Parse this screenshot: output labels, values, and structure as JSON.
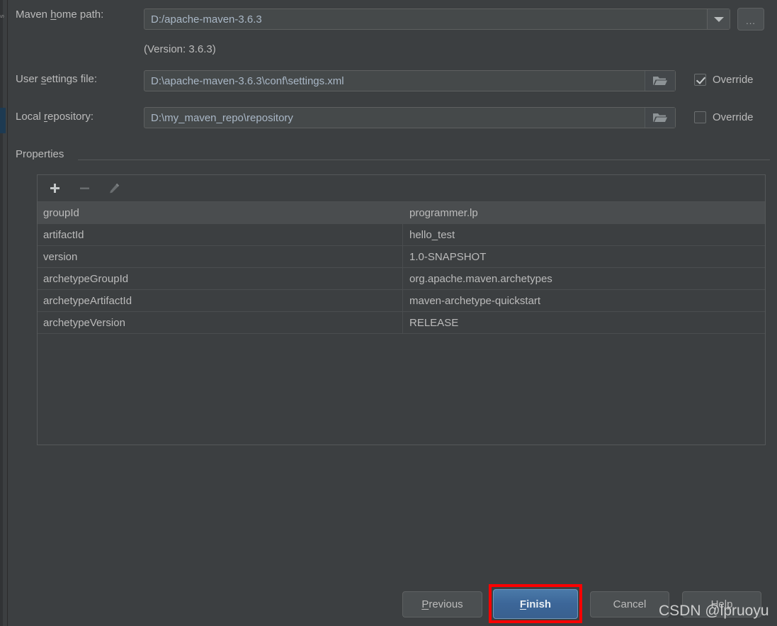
{
  "theme": {
    "background": "#3c3f41",
    "field_background": "#45494a",
    "text": "#bbbbbb",
    "value_text": "#a9b7c6",
    "accent_blue": "#3c6698",
    "highlight_red": "#ff0000",
    "left_strip_blue": "#1d3a52"
  },
  "left_strip": {
    "glyph": "s"
  },
  "form": {
    "maven_home": {
      "label_before": "Maven ",
      "label_mnemonic": "h",
      "label_after": "ome path:",
      "value": "D:/apache-maven-3.6.3",
      "dropdown_icon": "chevron-down-icon",
      "browse_label": "...",
      "version_note": "(Version: 3.6.3)"
    },
    "user_settings": {
      "label_before": "User ",
      "label_mnemonic": "s",
      "label_after": "ettings file:",
      "value": "D:\\apache-maven-3.6.3\\conf\\settings.xml",
      "folder_icon": "folder-icon",
      "override_label": "Override",
      "override_checked": true
    },
    "local_repository": {
      "label_before": "Local ",
      "label_mnemonic": "r",
      "label_after": "epository:",
      "value": "D:\\my_maven_repo\\repository",
      "folder_icon": "folder-icon",
      "override_label": "Override",
      "override_checked": false
    }
  },
  "properties": {
    "group_title": "Properties",
    "toolbar": {
      "add_icon": "plus-icon",
      "remove_icon": "minus-icon",
      "edit_icon": "pencil-icon",
      "add_enabled": true,
      "remove_enabled": false,
      "edit_enabled": false
    },
    "rows": [
      {
        "key": "groupId",
        "value": "programmer.lp",
        "selected": true
      },
      {
        "key": "artifactId",
        "value": "hello_test",
        "selected": false
      },
      {
        "key": "version",
        "value": "1.0-SNAPSHOT",
        "selected": false
      },
      {
        "key": "archetypeGroupId",
        "value": "org.apache.maven.archetypes",
        "selected": false
      },
      {
        "key": "archetypeArtifactId",
        "value": "maven-archetype-quickstart",
        "selected": false
      },
      {
        "key": "archetypeVersion",
        "value": "RELEASE",
        "selected": false
      }
    ]
  },
  "buttons": {
    "previous": {
      "before": "",
      "mnemonic": "P",
      "after": "revious"
    },
    "finish": {
      "before": "",
      "mnemonic": "F",
      "after": "inish"
    },
    "cancel": {
      "before": "Cancel",
      "mnemonic": "",
      "after": ""
    },
    "help": {
      "before": "Help",
      "mnemonic": "",
      "after": ""
    }
  },
  "watermark": {
    "text": "CSDN @lpruoyu"
  }
}
